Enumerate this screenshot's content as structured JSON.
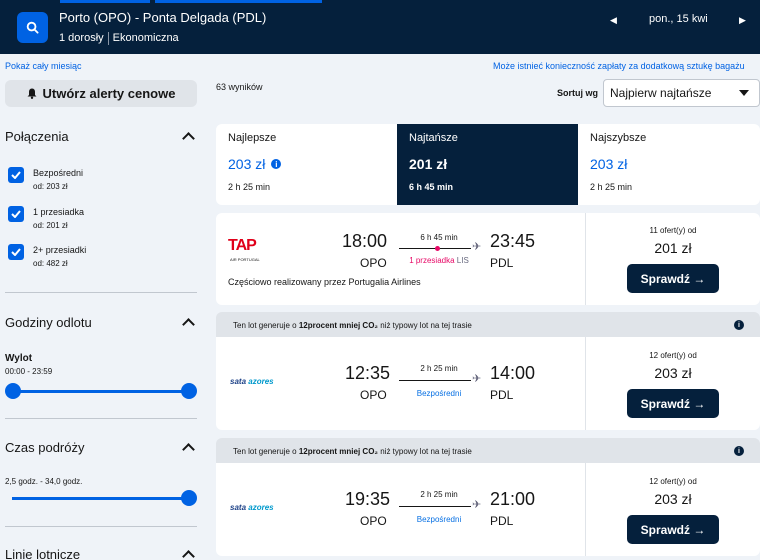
{
  "header": {
    "route": "Porto (OPO) - Ponta Delgada (PDL)",
    "passengers": "1 dorosły",
    "cabin": "Ekonomiczna",
    "date": "pon., 15 kwi"
  },
  "links": {
    "whole_month": "Pokaż cały miesiąc",
    "baggage_note": "Może istnieć konieczność zapłaty za dodatkową sztukę bagażu"
  },
  "alert_button": "Utwórz alerty cenowe",
  "results_count": "63 wyników",
  "sort": {
    "label": "Sortuj wg",
    "value": "Najpierw najtańsze"
  },
  "filters": {
    "connections": {
      "title": "Połączenia",
      "items": [
        {
          "label": "Bezpośredni",
          "sub": "od: 203 zł",
          "checked": true
        },
        {
          "label": "1 przesiadka",
          "sub": "od: 201 zł",
          "checked": true
        },
        {
          "label": "2+ przesiadki",
          "sub": "od: 482 zł",
          "checked": true
        }
      ]
    },
    "departure_times": {
      "title": "Godziny odlotu",
      "sub_title": "Wylot",
      "range": "00:00 - 23:59"
    },
    "travel_time": {
      "title": "Czas podróży",
      "range": "2,5 godz. - 34,0 godz."
    },
    "airlines": {
      "title": "Linie lotnicze"
    }
  },
  "tabs": [
    {
      "name": "Najlepsze",
      "price": "203 zł",
      "time": "2 h 25 min",
      "active": false
    },
    {
      "name": "Najtańsze",
      "price": "201 zł",
      "time": "6 h 45 min",
      "active": true
    },
    {
      "name": "Najszybsze",
      "price": "203 zł",
      "time": "2 h 25 min",
      "active": false
    }
  ],
  "co2_banner": {
    "prefix": "Ten lot generuje o",
    "highlight": "12procent mniej CO₂",
    "suffix": "niż typowy lot na tej trasie"
  },
  "flights": [
    {
      "airline": "TAP",
      "airline_sub": "AIR PORTUGAL",
      "dep_time": "18:00",
      "dep_code": "OPO",
      "arr_time": "23:45",
      "arr_code": "PDL",
      "duration": "6 h 45 min",
      "stops": "1 przesiadka",
      "via": "LIS",
      "operated_by": "Częściowo realizowany przez Portugalia Airlines",
      "offers": "11 ofert(y) od",
      "price": "201 zł",
      "button": "Sprawdź →"
    },
    {
      "airline": "sata",
      "airline_accent": "azores",
      "dep_time": "12:35",
      "dep_code": "OPO",
      "arr_time": "14:00",
      "arr_code": "PDL",
      "duration": "2 h 25 min",
      "stops": "Bezpośredni",
      "offers": "12 ofert(y) od",
      "price": "203 zł",
      "button": "Sprawdź →"
    },
    {
      "airline": "sata",
      "airline_accent": "azores",
      "dep_time": "19:35",
      "dep_code": "OPO",
      "arr_time": "21:00",
      "arr_code": "PDL",
      "duration": "2 h 25 min",
      "stops": "Bezpośredni",
      "offers": "12 ofert(y) od",
      "price": "203 zł",
      "button": "Sprawdź →"
    }
  ],
  "colors": {
    "navy": "#05203c",
    "blue": "#0062e3",
    "stop_red": "#e70866"
  }
}
